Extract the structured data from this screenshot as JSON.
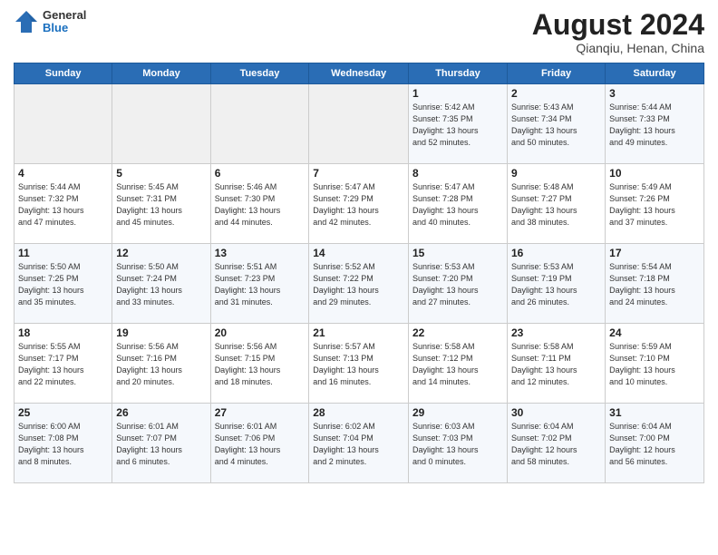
{
  "header": {
    "logo_general": "General",
    "logo_blue": "Blue",
    "title": "August 2024",
    "subtitle": "Qianqiu, Henan, China"
  },
  "weekdays": [
    "Sunday",
    "Monday",
    "Tuesday",
    "Wednesday",
    "Thursday",
    "Friday",
    "Saturday"
  ],
  "weeks": [
    [
      {
        "num": "",
        "info": ""
      },
      {
        "num": "",
        "info": ""
      },
      {
        "num": "",
        "info": ""
      },
      {
        "num": "",
        "info": ""
      },
      {
        "num": "1",
        "info": "Sunrise: 5:42 AM\nSunset: 7:35 PM\nDaylight: 13 hours\nand 52 minutes."
      },
      {
        "num": "2",
        "info": "Sunrise: 5:43 AM\nSunset: 7:34 PM\nDaylight: 13 hours\nand 50 minutes."
      },
      {
        "num": "3",
        "info": "Sunrise: 5:44 AM\nSunset: 7:33 PM\nDaylight: 13 hours\nand 49 minutes."
      }
    ],
    [
      {
        "num": "4",
        "info": "Sunrise: 5:44 AM\nSunset: 7:32 PM\nDaylight: 13 hours\nand 47 minutes."
      },
      {
        "num": "5",
        "info": "Sunrise: 5:45 AM\nSunset: 7:31 PM\nDaylight: 13 hours\nand 45 minutes."
      },
      {
        "num": "6",
        "info": "Sunrise: 5:46 AM\nSunset: 7:30 PM\nDaylight: 13 hours\nand 44 minutes."
      },
      {
        "num": "7",
        "info": "Sunrise: 5:47 AM\nSunset: 7:29 PM\nDaylight: 13 hours\nand 42 minutes."
      },
      {
        "num": "8",
        "info": "Sunrise: 5:47 AM\nSunset: 7:28 PM\nDaylight: 13 hours\nand 40 minutes."
      },
      {
        "num": "9",
        "info": "Sunrise: 5:48 AM\nSunset: 7:27 PM\nDaylight: 13 hours\nand 38 minutes."
      },
      {
        "num": "10",
        "info": "Sunrise: 5:49 AM\nSunset: 7:26 PM\nDaylight: 13 hours\nand 37 minutes."
      }
    ],
    [
      {
        "num": "11",
        "info": "Sunrise: 5:50 AM\nSunset: 7:25 PM\nDaylight: 13 hours\nand 35 minutes."
      },
      {
        "num": "12",
        "info": "Sunrise: 5:50 AM\nSunset: 7:24 PM\nDaylight: 13 hours\nand 33 minutes."
      },
      {
        "num": "13",
        "info": "Sunrise: 5:51 AM\nSunset: 7:23 PM\nDaylight: 13 hours\nand 31 minutes."
      },
      {
        "num": "14",
        "info": "Sunrise: 5:52 AM\nSunset: 7:22 PM\nDaylight: 13 hours\nand 29 minutes."
      },
      {
        "num": "15",
        "info": "Sunrise: 5:53 AM\nSunset: 7:20 PM\nDaylight: 13 hours\nand 27 minutes."
      },
      {
        "num": "16",
        "info": "Sunrise: 5:53 AM\nSunset: 7:19 PM\nDaylight: 13 hours\nand 26 minutes."
      },
      {
        "num": "17",
        "info": "Sunrise: 5:54 AM\nSunset: 7:18 PM\nDaylight: 13 hours\nand 24 minutes."
      }
    ],
    [
      {
        "num": "18",
        "info": "Sunrise: 5:55 AM\nSunset: 7:17 PM\nDaylight: 13 hours\nand 22 minutes."
      },
      {
        "num": "19",
        "info": "Sunrise: 5:56 AM\nSunset: 7:16 PM\nDaylight: 13 hours\nand 20 minutes."
      },
      {
        "num": "20",
        "info": "Sunrise: 5:56 AM\nSunset: 7:15 PM\nDaylight: 13 hours\nand 18 minutes."
      },
      {
        "num": "21",
        "info": "Sunrise: 5:57 AM\nSunset: 7:13 PM\nDaylight: 13 hours\nand 16 minutes."
      },
      {
        "num": "22",
        "info": "Sunrise: 5:58 AM\nSunset: 7:12 PM\nDaylight: 13 hours\nand 14 minutes."
      },
      {
        "num": "23",
        "info": "Sunrise: 5:58 AM\nSunset: 7:11 PM\nDaylight: 13 hours\nand 12 minutes."
      },
      {
        "num": "24",
        "info": "Sunrise: 5:59 AM\nSunset: 7:10 PM\nDaylight: 13 hours\nand 10 minutes."
      }
    ],
    [
      {
        "num": "25",
        "info": "Sunrise: 6:00 AM\nSunset: 7:08 PM\nDaylight: 13 hours\nand 8 minutes."
      },
      {
        "num": "26",
        "info": "Sunrise: 6:01 AM\nSunset: 7:07 PM\nDaylight: 13 hours\nand 6 minutes."
      },
      {
        "num": "27",
        "info": "Sunrise: 6:01 AM\nSunset: 7:06 PM\nDaylight: 13 hours\nand 4 minutes."
      },
      {
        "num": "28",
        "info": "Sunrise: 6:02 AM\nSunset: 7:04 PM\nDaylight: 13 hours\nand 2 minutes."
      },
      {
        "num": "29",
        "info": "Sunrise: 6:03 AM\nSunset: 7:03 PM\nDaylight: 13 hours\nand 0 minutes."
      },
      {
        "num": "30",
        "info": "Sunrise: 6:04 AM\nSunset: 7:02 PM\nDaylight: 12 hours\nand 58 minutes."
      },
      {
        "num": "31",
        "info": "Sunrise: 6:04 AM\nSunset: 7:00 PM\nDaylight: 12 hours\nand 56 minutes."
      }
    ]
  ]
}
